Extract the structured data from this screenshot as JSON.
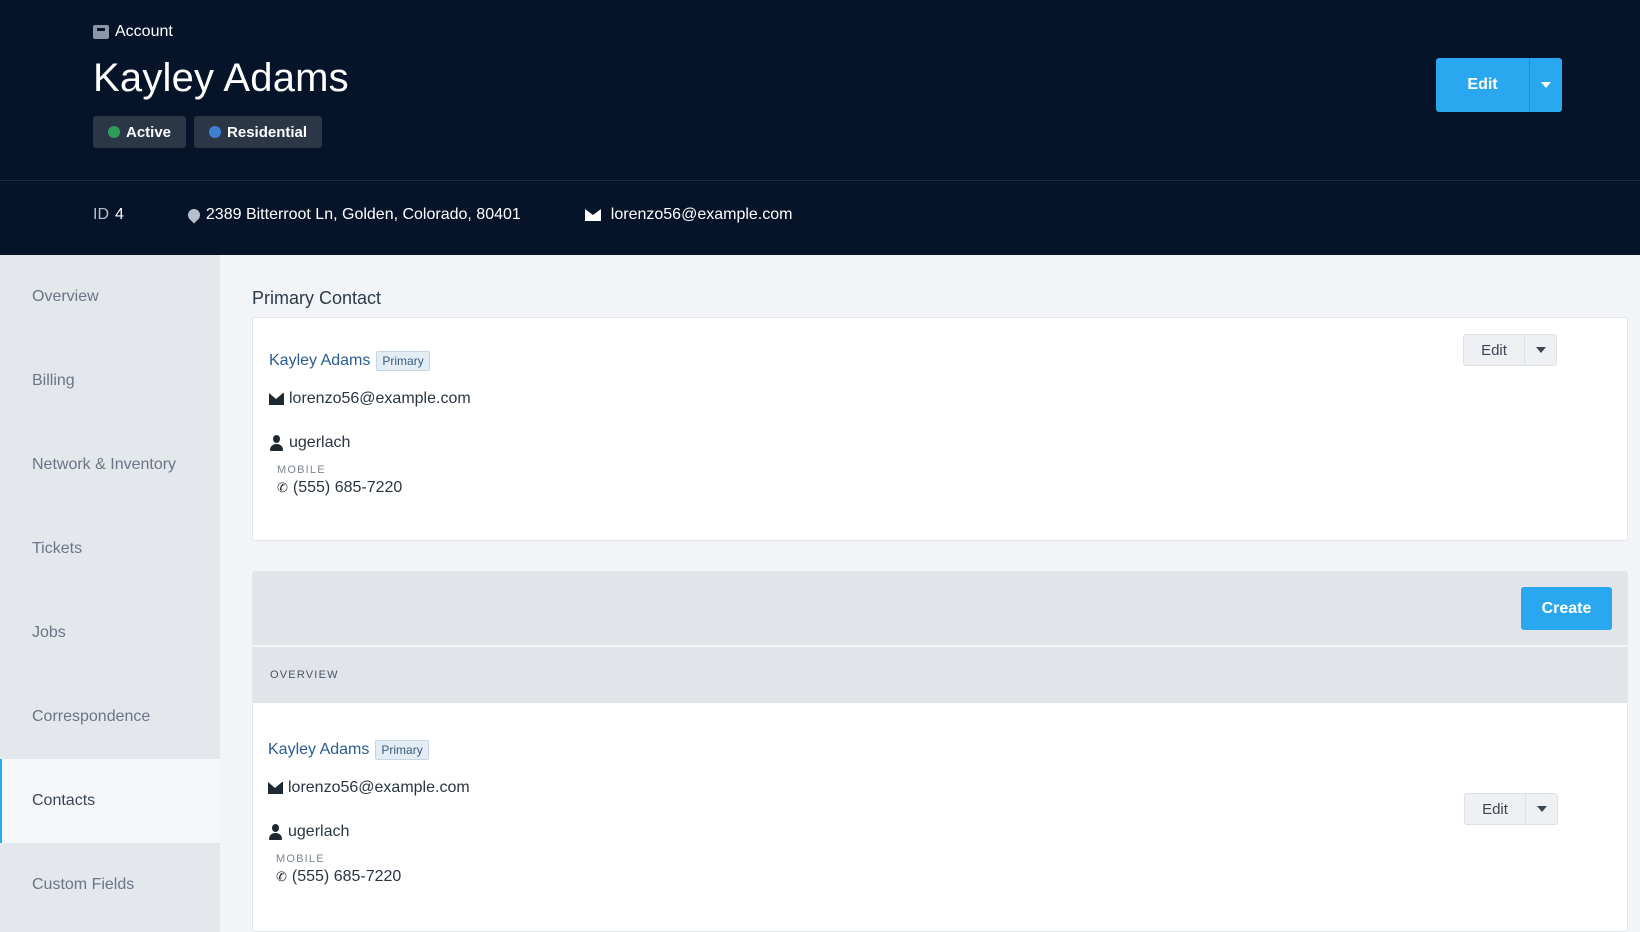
{
  "header": {
    "breadcrumb": "Account",
    "title": "Kayley Adams",
    "badges": [
      {
        "label": "Active",
        "color": "#2e9e5b"
      },
      {
        "label": "Residential",
        "color": "#3d7fd1"
      }
    ],
    "edit_label": "Edit",
    "id_label": "ID",
    "id_value": "4",
    "address": "2389 Bitterroot Ln, Golden, Colorado, 80401",
    "email": "lorenzo56@example.com"
  },
  "sidebar": {
    "items": [
      {
        "label": "Overview"
      },
      {
        "label": "Billing"
      },
      {
        "label": "Network & Inventory"
      },
      {
        "label": "Tickets"
      },
      {
        "label": "Jobs"
      },
      {
        "label": "Correspondence"
      },
      {
        "label": "Contacts"
      },
      {
        "label": "Custom Fields"
      }
    ],
    "active": "Contacts"
  },
  "primary_contact": {
    "section_title": "Primary Contact",
    "name": "Kayley Adams",
    "tag": "Primary",
    "email": "lorenzo56@example.com",
    "username": "ugerlach",
    "phone_label": "MOBILE",
    "phone": "(555) 685-7220",
    "edit_label": "Edit"
  },
  "contacts_list": {
    "create_label": "Create",
    "group_label": "OVERVIEW",
    "items": [
      {
        "name": "Kayley Adams",
        "tag": "Primary",
        "email": "lorenzo56@example.com",
        "username": "ugerlach",
        "phone_label": "MOBILE",
        "phone": "(555) 685-7220",
        "edit_label": "Edit"
      }
    ]
  },
  "colors": {
    "header_bg": "#061429",
    "accent": "#29a8ef"
  }
}
